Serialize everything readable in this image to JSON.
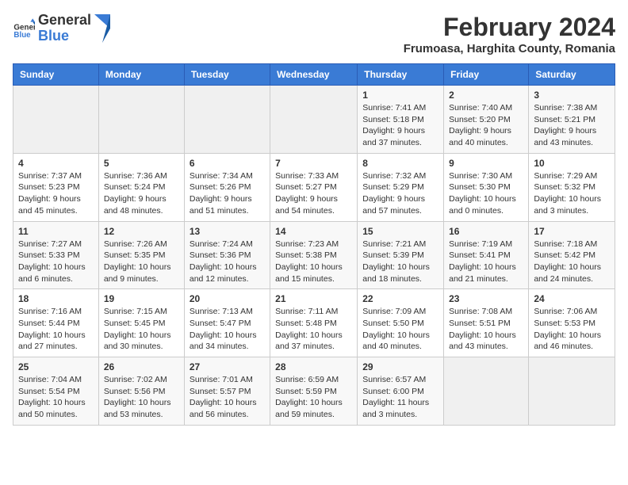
{
  "logo": {
    "general": "General",
    "blue": "Blue"
  },
  "header": {
    "title": "February 2024",
    "subtitle": "Frumoasa, Harghita County, Romania"
  },
  "columns": [
    "Sunday",
    "Monday",
    "Tuesday",
    "Wednesday",
    "Thursday",
    "Friday",
    "Saturday"
  ],
  "weeks": [
    [
      {
        "day": "",
        "info": ""
      },
      {
        "day": "",
        "info": ""
      },
      {
        "day": "",
        "info": ""
      },
      {
        "day": "",
        "info": ""
      },
      {
        "day": "1",
        "info": "Sunrise: 7:41 AM\nSunset: 5:18 PM\nDaylight: 9 hours and 37 minutes."
      },
      {
        "day": "2",
        "info": "Sunrise: 7:40 AM\nSunset: 5:20 PM\nDaylight: 9 hours and 40 minutes."
      },
      {
        "day": "3",
        "info": "Sunrise: 7:38 AM\nSunset: 5:21 PM\nDaylight: 9 hours and 43 minutes."
      }
    ],
    [
      {
        "day": "4",
        "info": "Sunrise: 7:37 AM\nSunset: 5:23 PM\nDaylight: 9 hours and 45 minutes."
      },
      {
        "day": "5",
        "info": "Sunrise: 7:36 AM\nSunset: 5:24 PM\nDaylight: 9 hours and 48 minutes."
      },
      {
        "day": "6",
        "info": "Sunrise: 7:34 AM\nSunset: 5:26 PM\nDaylight: 9 hours and 51 minutes."
      },
      {
        "day": "7",
        "info": "Sunrise: 7:33 AM\nSunset: 5:27 PM\nDaylight: 9 hours and 54 minutes."
      },
      {
        "day": "8",
        "info": "Sunrise: 7:32 AM\nSunset: 5:29 PM\nDaylight: 9 hours and 57 minutes."
      },
      {
        "day": "9",
        "info": "Sunrise: 7:30 AM\nSunset: 5:30 PM\nDaylight: 10 hours and 0 minutes."
      },
      {
        "day": "10",
        "info": "Sunrise: 7:29 AM\nSunset: 5:32 PM\nDaylight: 10 hours and 3 minutes."
      }
    ],
    [
      {
        "day": "11",
        "info": "Sunrise: 7:27 AM\nSunset: 5:33 PM\nDaylight: 10 hours and 6 minutes."
      },
      {
        "day": "12",
        "info": "Sunrise: 7:26 AM\nSunset: 5:35 PM\nDaylight: 10 hours and 9 minutes."
      },
      {
        "day": "13",
        "info": "Sunrise: 7:24 AM\nSunset: 5:36 PM\nDaylight: 10 hours and 12 minutes."
      },
      {
        "day": "14",
        "info": "Sunrise: 7:23 AM\nSunset: 5:38 PM\nDaylight: 10 hours and 15 minutes."
      },
      {
        "day": "15",
        "info": "Sunrise: 7:21 AM\nSunset: 5:39 PM\nDaylight: 10 hours and 18 minutes."
      },
      {
        "day": "16",
        "info": "Sunrise: 7:19 AM\nSunset: 5:41 PM\nDaylight: 10 hours and 21 minutes."
      },
      {
        "day": "17",
        "info": "Sunrise: 7:18 AM\nSunset: 5:42 PM\nDaylight: 10 hours and 24 minutes."
      }
    ],
    [
      {
        "day": "18",
        "info": "Sunrise: 7:16 AM\nSunset: 5:44 PM\nDaylight: 10 hours and 27 minutes."
      },
      {
        "day": "19",
        "info": "Sunrise: 7:15 AM\nSunset: 5:45 PM\nDaylight: 10 hours and 30 minutes."
      },
      {
        "day": "20",
        "info": "Sunrise: 7:13 AM\nSunset: 5:47 PM\nDaylight: 10 hours and 34 minutes."
      },
      {
        "day": "21",
        "info": "Sunrise: 7:11 AM\nSunset: 5:48 PM\nDaylight: 10 hours and 37 minutes."
      },
      {
        "day": "22",
        "info": "Sunrise: 7:09 AM\nSunset: 5:50 PM\nDaylight: 10 hours and 40 minutes."
      },
      {
        "day": "23",
        "info": "Sunrise: 7:08 AM\nSunset: 5:51 PM\nDaylight: 10 hours and 43 minutes."
      },
      {
        "day": "24",
        "info": "Sunrise: 7:06 AM\nSunset: 5:53 PM\nDaylight: 10 hours and 46 minutes."
      }
    ],
    [
      {
        "day": "25",
        "info": "Sunrise: 7:04 AM\nSunset: 5:54 PM\nDaylight: 10 hours and 50 minutes."
      },
      {
        "day": "26",
        "info": "Sunrise: 7:02 AM\nSunset: 5:56 PM\nDaylight: 10 hours and 53 minutes."
      },
      {
        "day": "27",
        "info": "Sunrise: 7:01 AM\nSunset: 5:57 PM\nDaylight: 10 hours and 56 minutes."
      },
      {
        "day": "28",
        "info": "Sunrise: 6:59 AM\nSunset: 5:59 PM\nDaylight: 10 hours and 59 minutes."
      },
      {
        "day": "29",
        "info": "Sunrise: 6:57 AM\nSunset: 6:00 PM\nDaylight: 11 hours and 3 minutes."
      },
      {
        "day": "",
        "info": ""
      },
      {
        "day": "",
        "info": ""
      }
    ]
  ]
}
